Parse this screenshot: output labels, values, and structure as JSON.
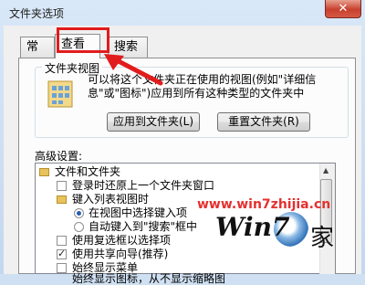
{
  "window": {
    "title": "文件夹选项",
    "close_glyph": "✕"
  },
  "tabs": [
    {
      "label": "常规"
    },
    {
      "label": "查看"
    },
    {
      "label": "搜索"
    }
  ],
  "folder_views": {
    "group_title": "文件夹视图",
    "description": "可以将这个文件夹正在使用的视图(例如\"详细信息\"或\"图标\")应用到所有这种类型的文件夹中",
    "apply_button": "应用到文件夹(L)",
    "reset_button": "重置文件夹(R)"
  },
  "advanced": {
    "label": "高级设置:",
    "items": [
      {
        "text": "文件和文件夹",
        "kind": "folder"
      },
      {
        "text": "登录时还原上一个文件夹窗口",
        "kind": "checkbox",
        "checked": false
      },
      {
        "text": "键入列表视图时",
        "kind": "folder"
      },
      {
        "text": "在视图中选择键入项",
        "kind": "radio",
        "checked": true
      },
      {
        "text": "自动键入到\"搜索\"框中",
        "kind": "radio",
        "checked": false
      },
      {
        "text": "使用复选框以选择项",
        "kind": "checkbox",
        "checked": false
      },
      {
        "text": "使用共享向导(推荐)",
        "kind": "checkbox",
        "checked": true
      },
      {
        "text": "始终显示菜单",
        "kind": "checkbox",
        "checked": false
      },
      {
        "text": "始终显示图标，从不显示缩略图",
        "kind": "checkbox",
        "checked": false
      }
    ]
  },
  "watermark": {
    "url": "www.win7zhijia.cn",
    "logo": "Win7",
    "suffix": "家"
  },
  "colors": {
    "highlight": "#e21c1c",
    "watermark_url": "#e53030"
  }
}
